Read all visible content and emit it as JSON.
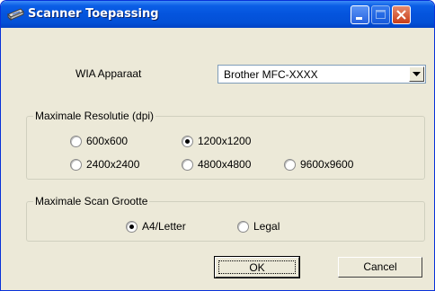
{
  "window": {
    "title": "Scanner Toepassing"
  },
  "device": {
    "label": "WIA Apparaat",
    "selected": "Brother MFC-XXXX"
  },
  "resolution": {
    "legend": "Maximale Resolutie (dpi)",
    "options": [
      {
        "label": "600x600",
        "selected": false
      },
      {
        "label": "1200x1200",
        "selected": true
      },
      {
        "label": "2400x2400",
        "selected": false
      },
      {
        "label": "4800x4800",
        "selected": false
      },
      {
        "label": "9600x9600",
        "selected": false
      }
    ]
  },
  "scan_size": {
    "legend": "Maximale Scan Grootte",
    "options": [
      {
        "label": "A4/Letter",
        "selected": true
      },
      {
        "label": "Legal",
        "selected": false
      }
    ]
  },
  "buttons": {
    "ok": "OK",
    "cancel": "Cancel"
  }
}
